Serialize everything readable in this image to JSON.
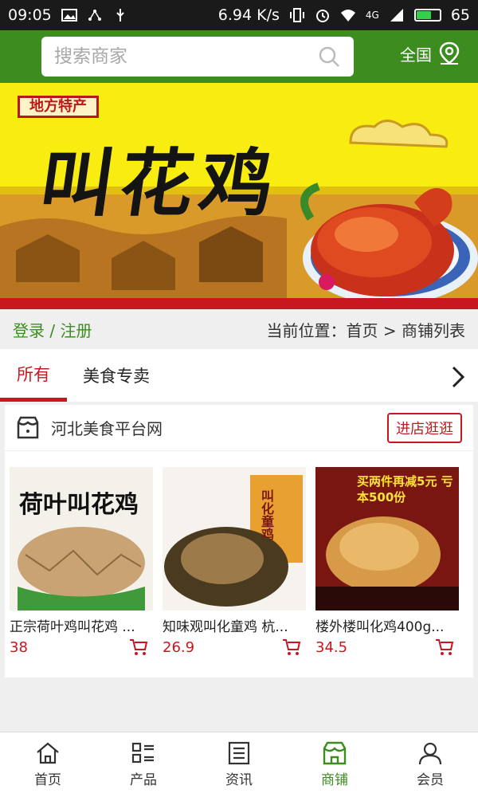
{
  "status_bar": {
    "time": "09:05",
    "speed": "6.94 K/s",
    "network": "4G",
    "battery": "65"
  },
  "header": {
    "search_placeholder": "搜索商家",
    "region": "全国"
  },
  "banner": {
    "tag": "地方特产",
    "title": "叫花鸡"
  },
  "location": {
    "login": "登录 / 注册",
    "breadcrumb": "当前位置：首页 > 商铺列表"
  },
  "tabs": [
    {
      "label": "所有",
      "active": true
    },
    {
      "label": "美食专卖",
      "active": false
    }
  ],
  "shop": {
    "name": "河北美食平台网",
    "enter_label": "进店逛逛",
    "products": [
      {
        "title": "正宗荷叶鸡叫花鸡 ...",
        "price": "38",
        "img_text": "荷叶叫花鸡"
      },
      {
        "title": "知味观叫化童鸡 杭...",
        "price": "26.9",
        "img_text": "叫化童鸡"
      },
      {
        "title": "楼外楼叫化鸡400g...",
        "price": "34.5",
        "img_text": "买两件再减5元 亏本500份"
      }
    ]
  },
  "tabbar": [
    {
      "label": "首页",
      "icon": "home-icon",
      "active": false
    },
    {
      "label": "产品",
      "icon": "product-grid-icon",
      "active": false
    },
    {
      "label": "资讯",
      "icon": "news-icon",
      "active": false
    },
    {
      "label": "商铺",
      "icon": "shop-icon",
      "active": true
    },
    {
      "label": "会员",
      "icon": "member-icon",
      "active": false
    }
  ],
  "colors": {
    "brand_green": "#3d8c1f",
    "accent_red": "#c8171f"
  }
}
